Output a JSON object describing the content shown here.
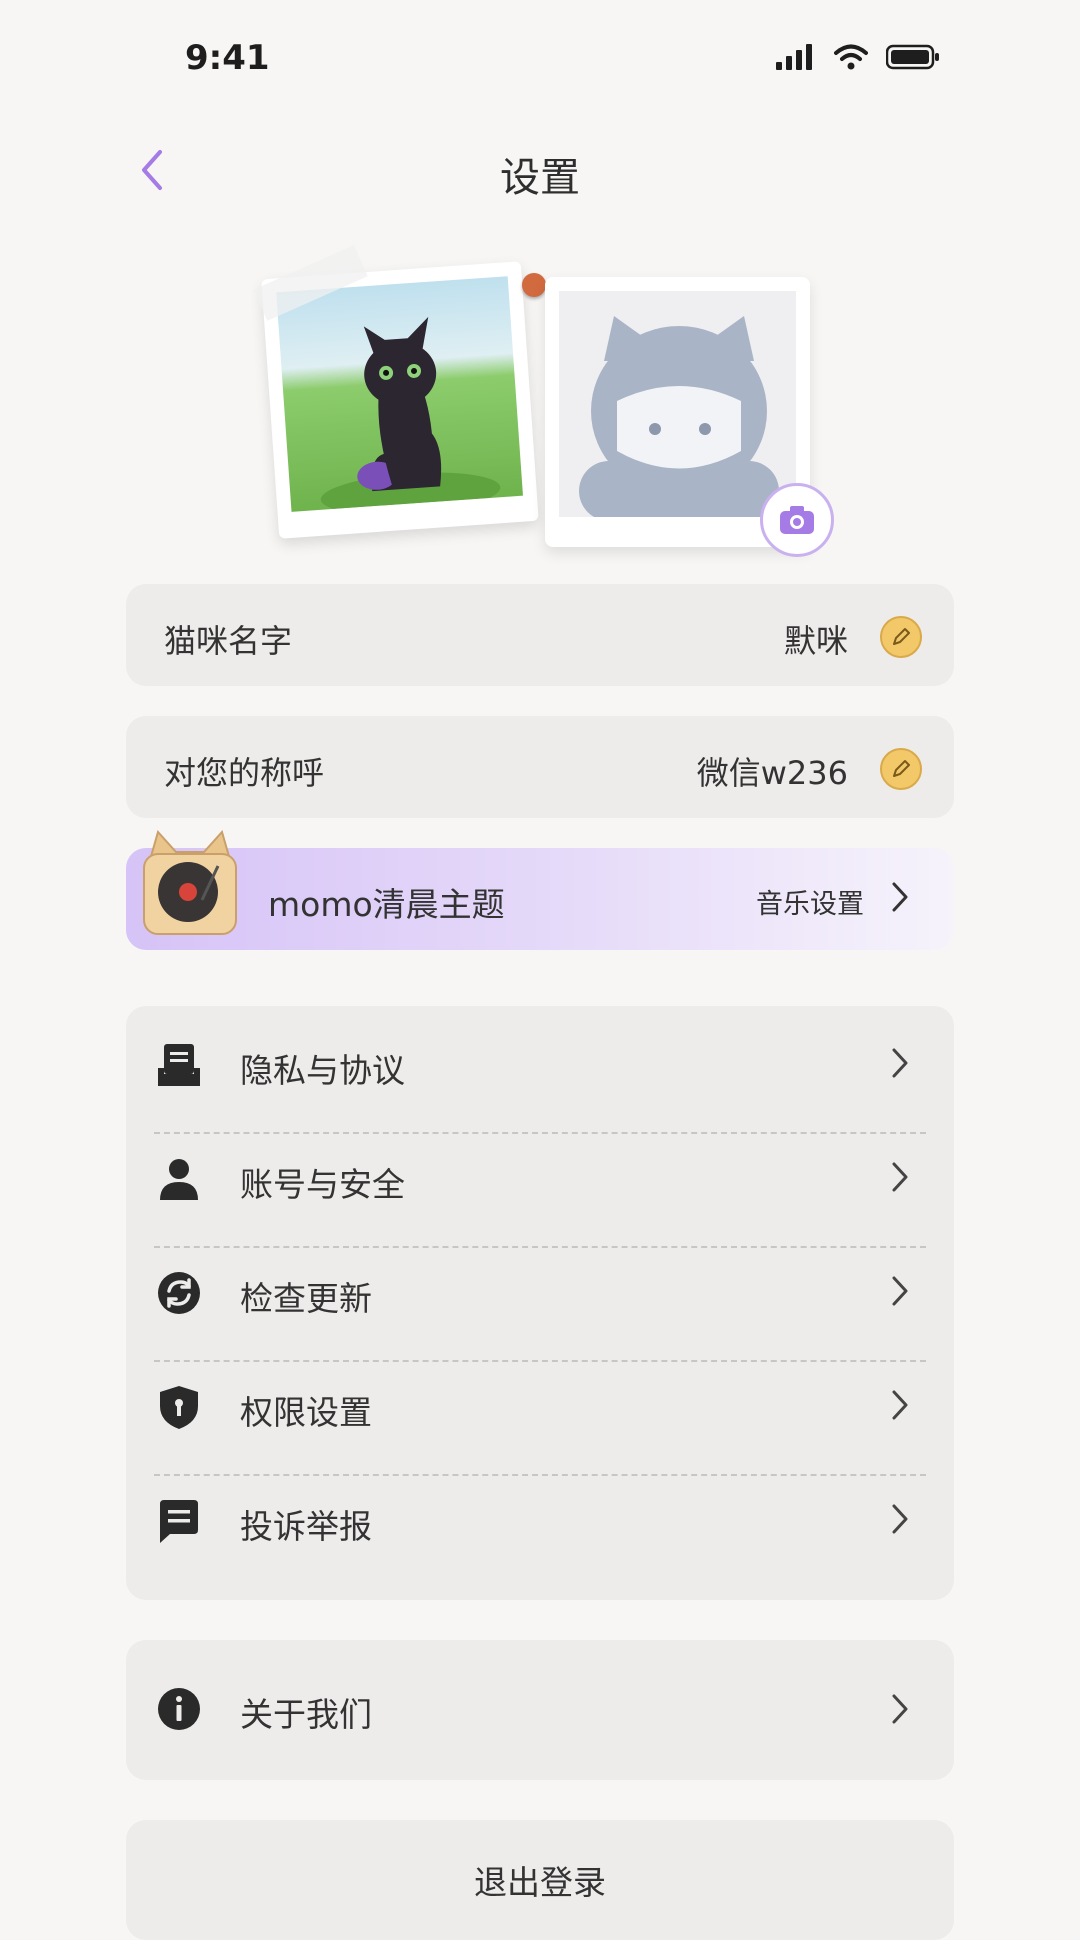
{
  "status_bar": {
    "time": "9:41"
  },
  "header": {
    "title": "设置"
  },
  "profile": {
    "camera_label": "camera"
  },
  "cat_name": {
    "label": "猫咪名字",
    "value": "默咪"
  },
  "nickname": {
    "label": "对您的称呼",
    "value": "微信w236"
  },
  "theme": {
    "label": "momo清晨主题",
    "link": "音乐设置"
  },
  "menu": {
    "items": [
      {
        "label": "隐私与协议",
        "icon": "document-icon"
      },
      {
        "label": "账号与安全",
        "icon": "user-icon"
      },
      {
        "label": "检查更新",
        "icon": "refresh-icon"
      },
      {
        "label": "权限设置",
        "icon": "shield-icon"
      },
      {
        "label": "投诉举报",
        "icon": "message-icon"
      }
    ]
  },
  "about": {
    "label": "关于我们"
  },
  "logout": {
    "label": "退出登录"
  },
  "colors": {
    "accent": "#a57be6",
    "edit": "#f2c868",
    "card": "#eeeceb"
  }
}
